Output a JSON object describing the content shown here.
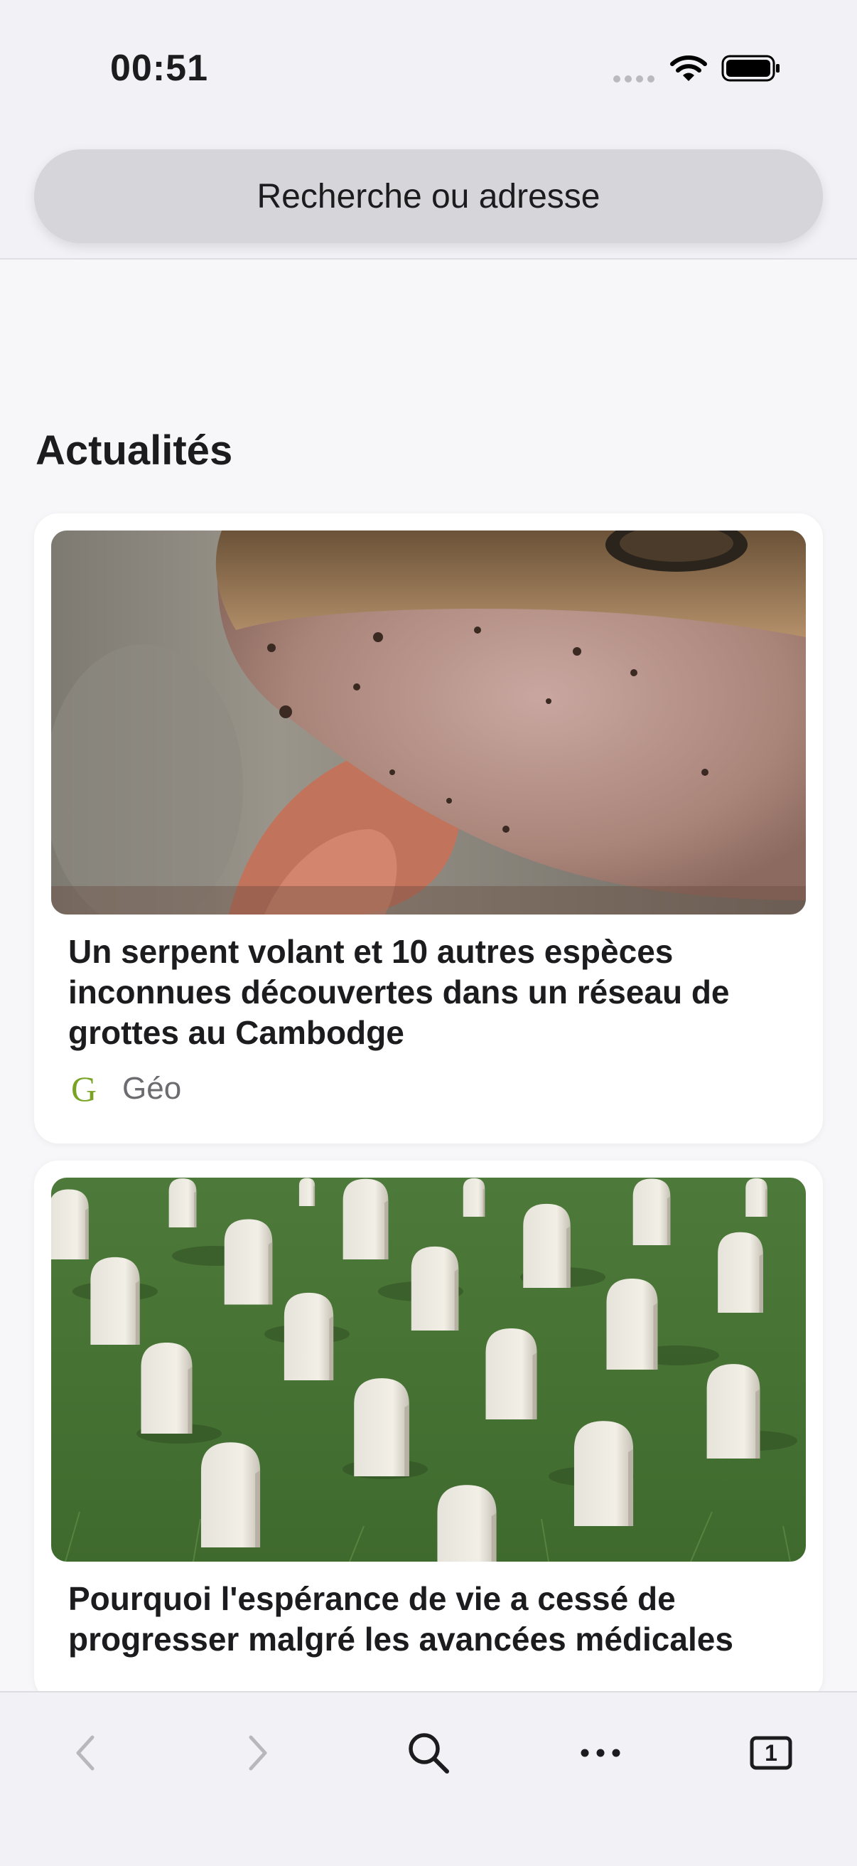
{
  "status_bar": {
    "time": "00:51"
  },
  "address_bar": {
    "placeholder": "Recherche ou adresse"
  },
  "section": {
    "title": "Actualités"
  },
  "articles": [
    {
      "title": "Un serpent volant et 10 autres espèces inconnues découvertes dans un réseau de grottes au Cambodge",
      "source_logo": "G",
      "source_name": "Géo",
      "image": "frog-closeup-photo"
    },
    {
      "title": "Pourquoi l'espérance de vie a cessé de progresser malgré les avancées médicales",
      "image": "military-cemetery-photo"
    }
  ],
  "toolbar": {
    "back_icon": "chevron-left-icon",
    "forward_icon": "chevron-right-icon",
    "search_icon": "magnifier-icon",
    "more_icon": "ellipsis-icon",
    "tabs_count": "1"
  },
  "colors": {
    "source_logo": "#7aa324",
    "background": "#f7f7f9",
    "toolbar": "#f2f2f6"
  }
}
